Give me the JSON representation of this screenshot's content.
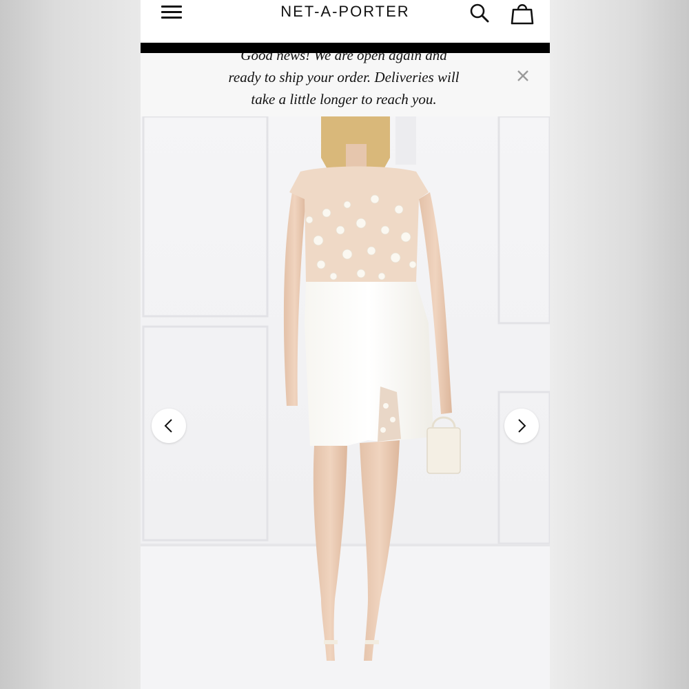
{
  "header": {
    "logo_text": "NET-A-PORTER",
    "menu_icon": "hamburger-menu-icon",
    "search_icon": "search-icon",
    "bag_icon": "shopping-bag-icon"
  },
  "banner": {
    "line1": "Good news! We are open again and",
    "line2": "ready to ship your order. Deliveries will",
    "line3": "take a little longer to reach you.",
    "close_icon": "close-icon"
  },
  "gallery": {
    "prev_icon": "chevron-left-icon",
    "next_icon": "chevron-right-icon"
  },
  "colors": {
    "header_bg": "#ffffff",
    "bar": "#000000",
    "banner_bg": "#f7f7f7",
    "text": "#111111"
  }
}
